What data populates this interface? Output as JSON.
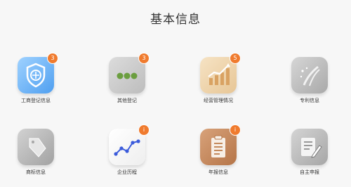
{
  "page": {
    "title": "基本信息"
  },
  "tiles": [
    {
      "label": "工商登记信息",
      "badge": "3",
      "icon": "shield-emblem-icon"
    },
    {
      "label": "其他登记",
      "badge": "3",
      "icon": "three-dots-icon"
    },
    {
      "label": "经营管理情况",
      "badge": "5",
      "icon": "bar-chart-trend-icon"
    },
    {
      "label": "专利信息",
      "badge": "",
      "icon": "patent-road-icon"
    },
    {
      "label": "商标信息",
      "badge": "",
      "icon": "tag-icon"
    },
    {
      "label": "企业历程",
      "badge": "i",
      "icon": "timeline-line-icon"
    },
    {
      "label": "年报信息",
      "badge": "i",
      "icon": "clipboard-report-icon"
    },
    {
      "label": "自主申报",
      "badge": "",
      "icon": "edit-document-icon"
    }
  ],
  "colors": {
    "badge": "#f07b2e",
    "blue_tile": "#4f9ff0",
    "timeline_line": "#3b5bdb"
  }
}
